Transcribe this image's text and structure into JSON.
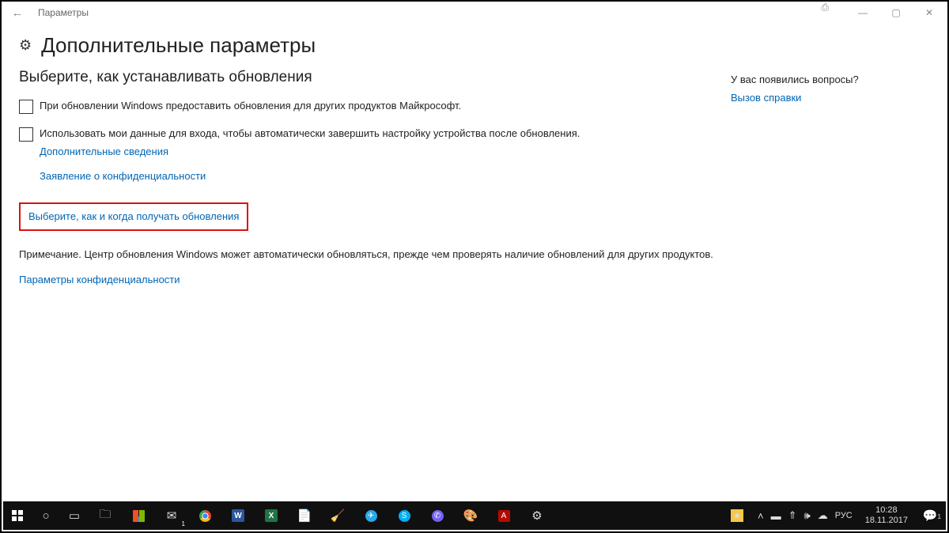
{
  "titlebar": {
    "back": "←",
    "title": "Параметры"
  },
  "window": {
    "min": "—",
    "max": "▢",
    "close": "✕"
  },
  "header": {
    "title": "Дополнительные параметры"
  },
  "main": {
    "subhead": "Выберите, как устанавливать обновления",
    "opt1": "При обновлении Windows предоставить обновления для других продуктов Майкрософт.",
    "opt2": "Использовать мои данные для входа, чтобы автоматически завершить настройку устройства после обновления.",
    "more_info": "Дополнительные сведения",
    "privacy_stmt": "Заявление о конфиденциальности",
    "choose_when": "Выберите, как и когда получать обновления",
    "note": "Примечание. Центр обновления Windows может автоматически обновляться, прежде чем проверять наличие обновлений для других продуктов.",
    "privacy_params": "Параметры конфиденциальности"
  },
  "side": {
    "question": "У вас появились вопросы?",
    "help": "Вызов справки"
  },
  "tray": {
    "lang": "РУС",
    "time": "10:28",
    "date": "18.11.2017"
  }
}
